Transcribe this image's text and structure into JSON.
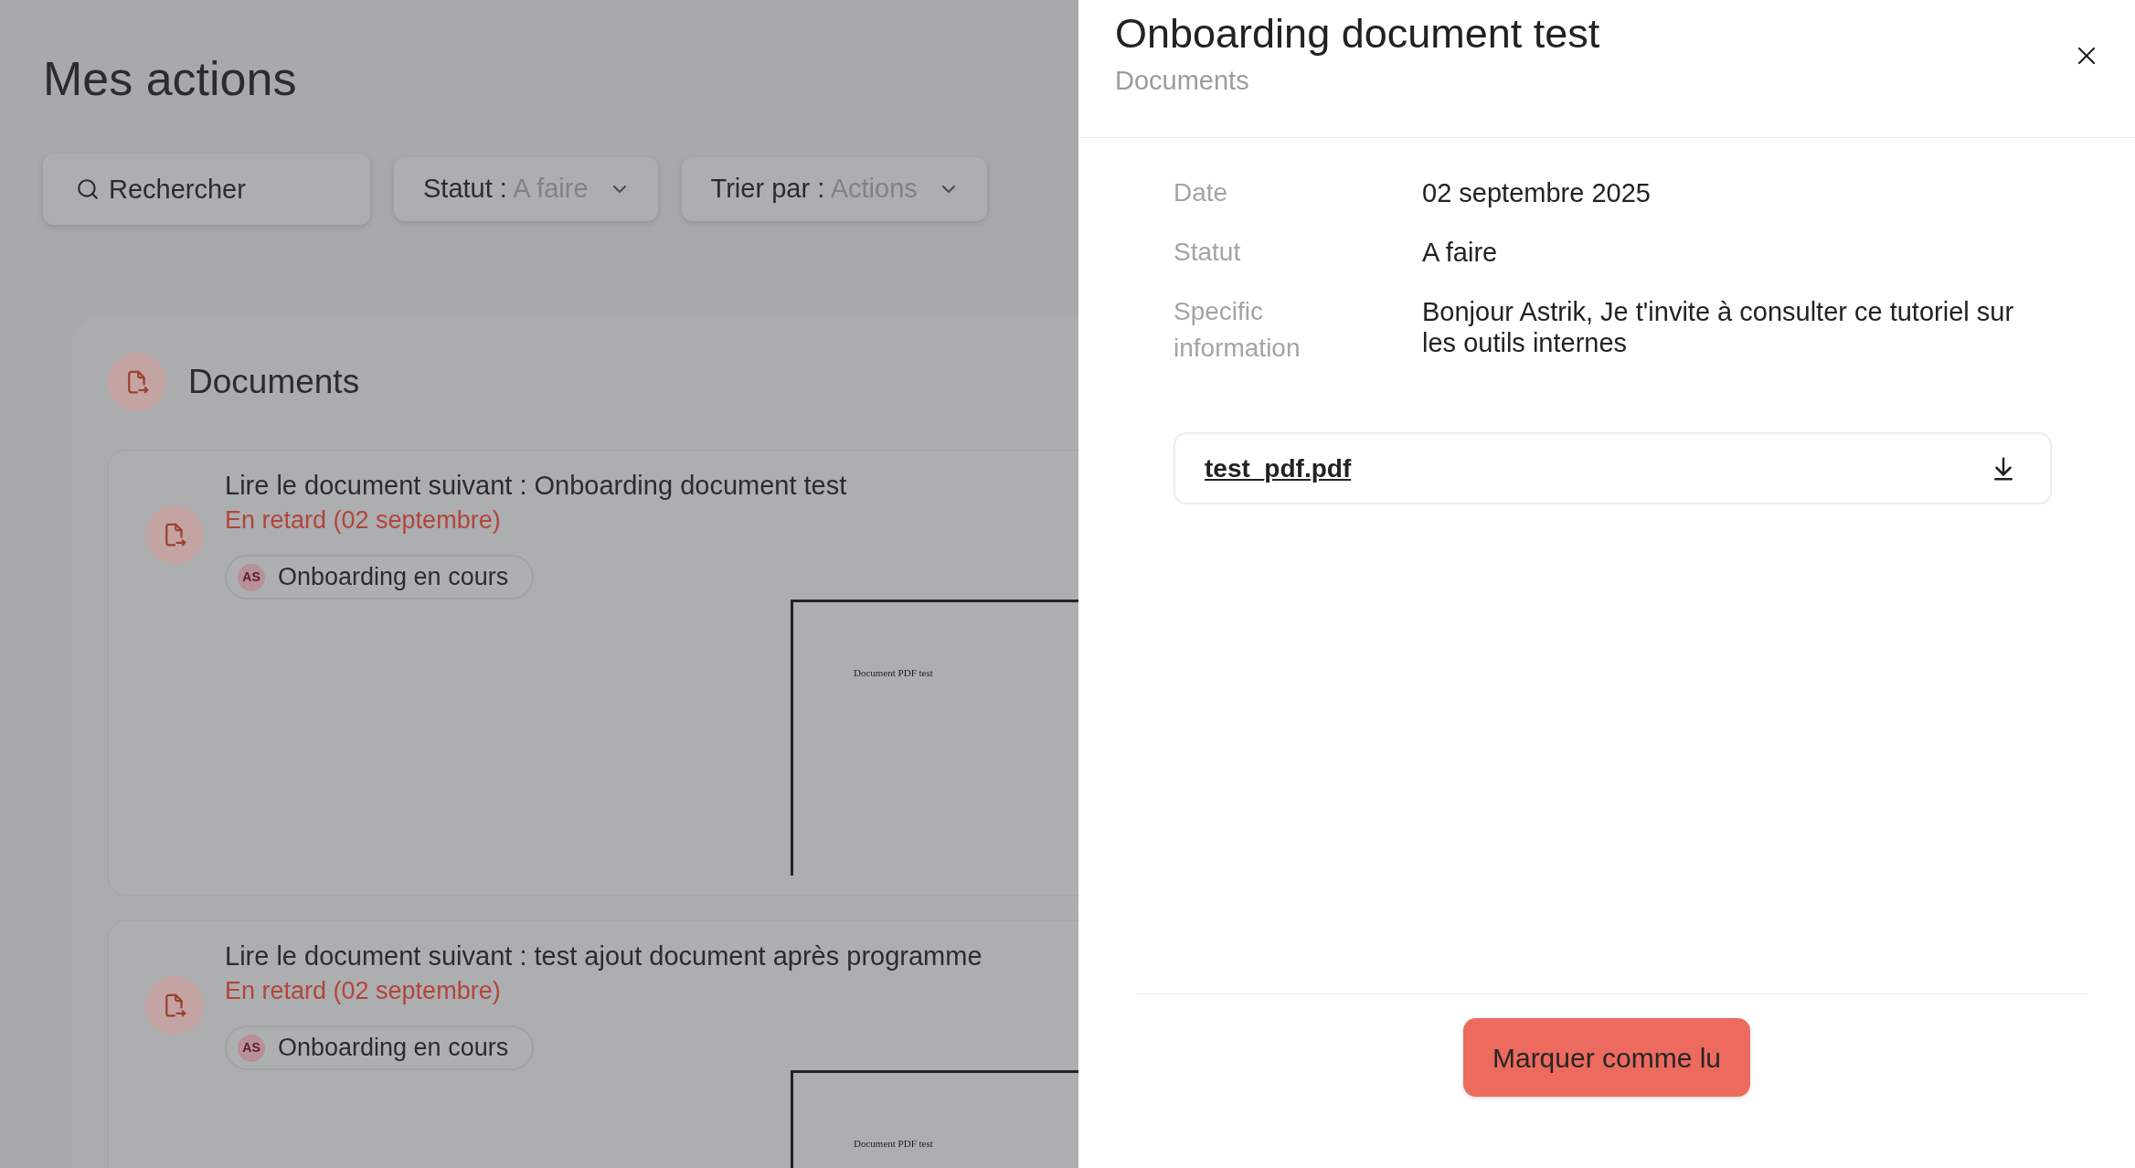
{
  "page": {
    "title": "Mes actions"
  },
  "filters": {
    "search": {
      "placeholder": "Rechercher"
    },
    "dropdowns": [
      {
        "label": "Statut :",
        "value": "A faire"
      },
      {
        "label": "Trier par :",
        "value": "Actions"
      }
    ]
  },
  "section": {
    "title": "Documents",
    "items": [
      {
        "title": "Lire le document suivant : Onboarding document test",
        "status": "En retard (02 septembre)",
        "tag": {
          "initials": "AS",
          "label": "Onboarding en cours"
        },
        "preview": {
          "text": "Document PDF test"
        }
      },
      {
        "title": "Lire le document suivant : test ajout document après programme",
        "status": "En retard (02 septembre)",
        "tag": {
          "initials": "AS",
          "label": "Onboarding en cours"
        },
        "preview": {
          "text": "Document PDF test"
        }
      }
    ]
  },
  "drawer": {
    "title": "Onboarding document test",
    "subtitle": "Documents",
    "details": [
      {
        "label": "Date",
        "value": "02 septembre 2025"
      },
      {
        "label": "Statut",
        "value": "A faire"
      },
      {
        "label": "Specific information",
        "value": "Bonjour Astrik, Je t'invite à consulter ce tutoriel sur les outils internes"
      }
    ],
    "attachment": {
      "filename": "test_pdf.pdf"
    },
    "button": "Marquer comme lu"
  }
}
